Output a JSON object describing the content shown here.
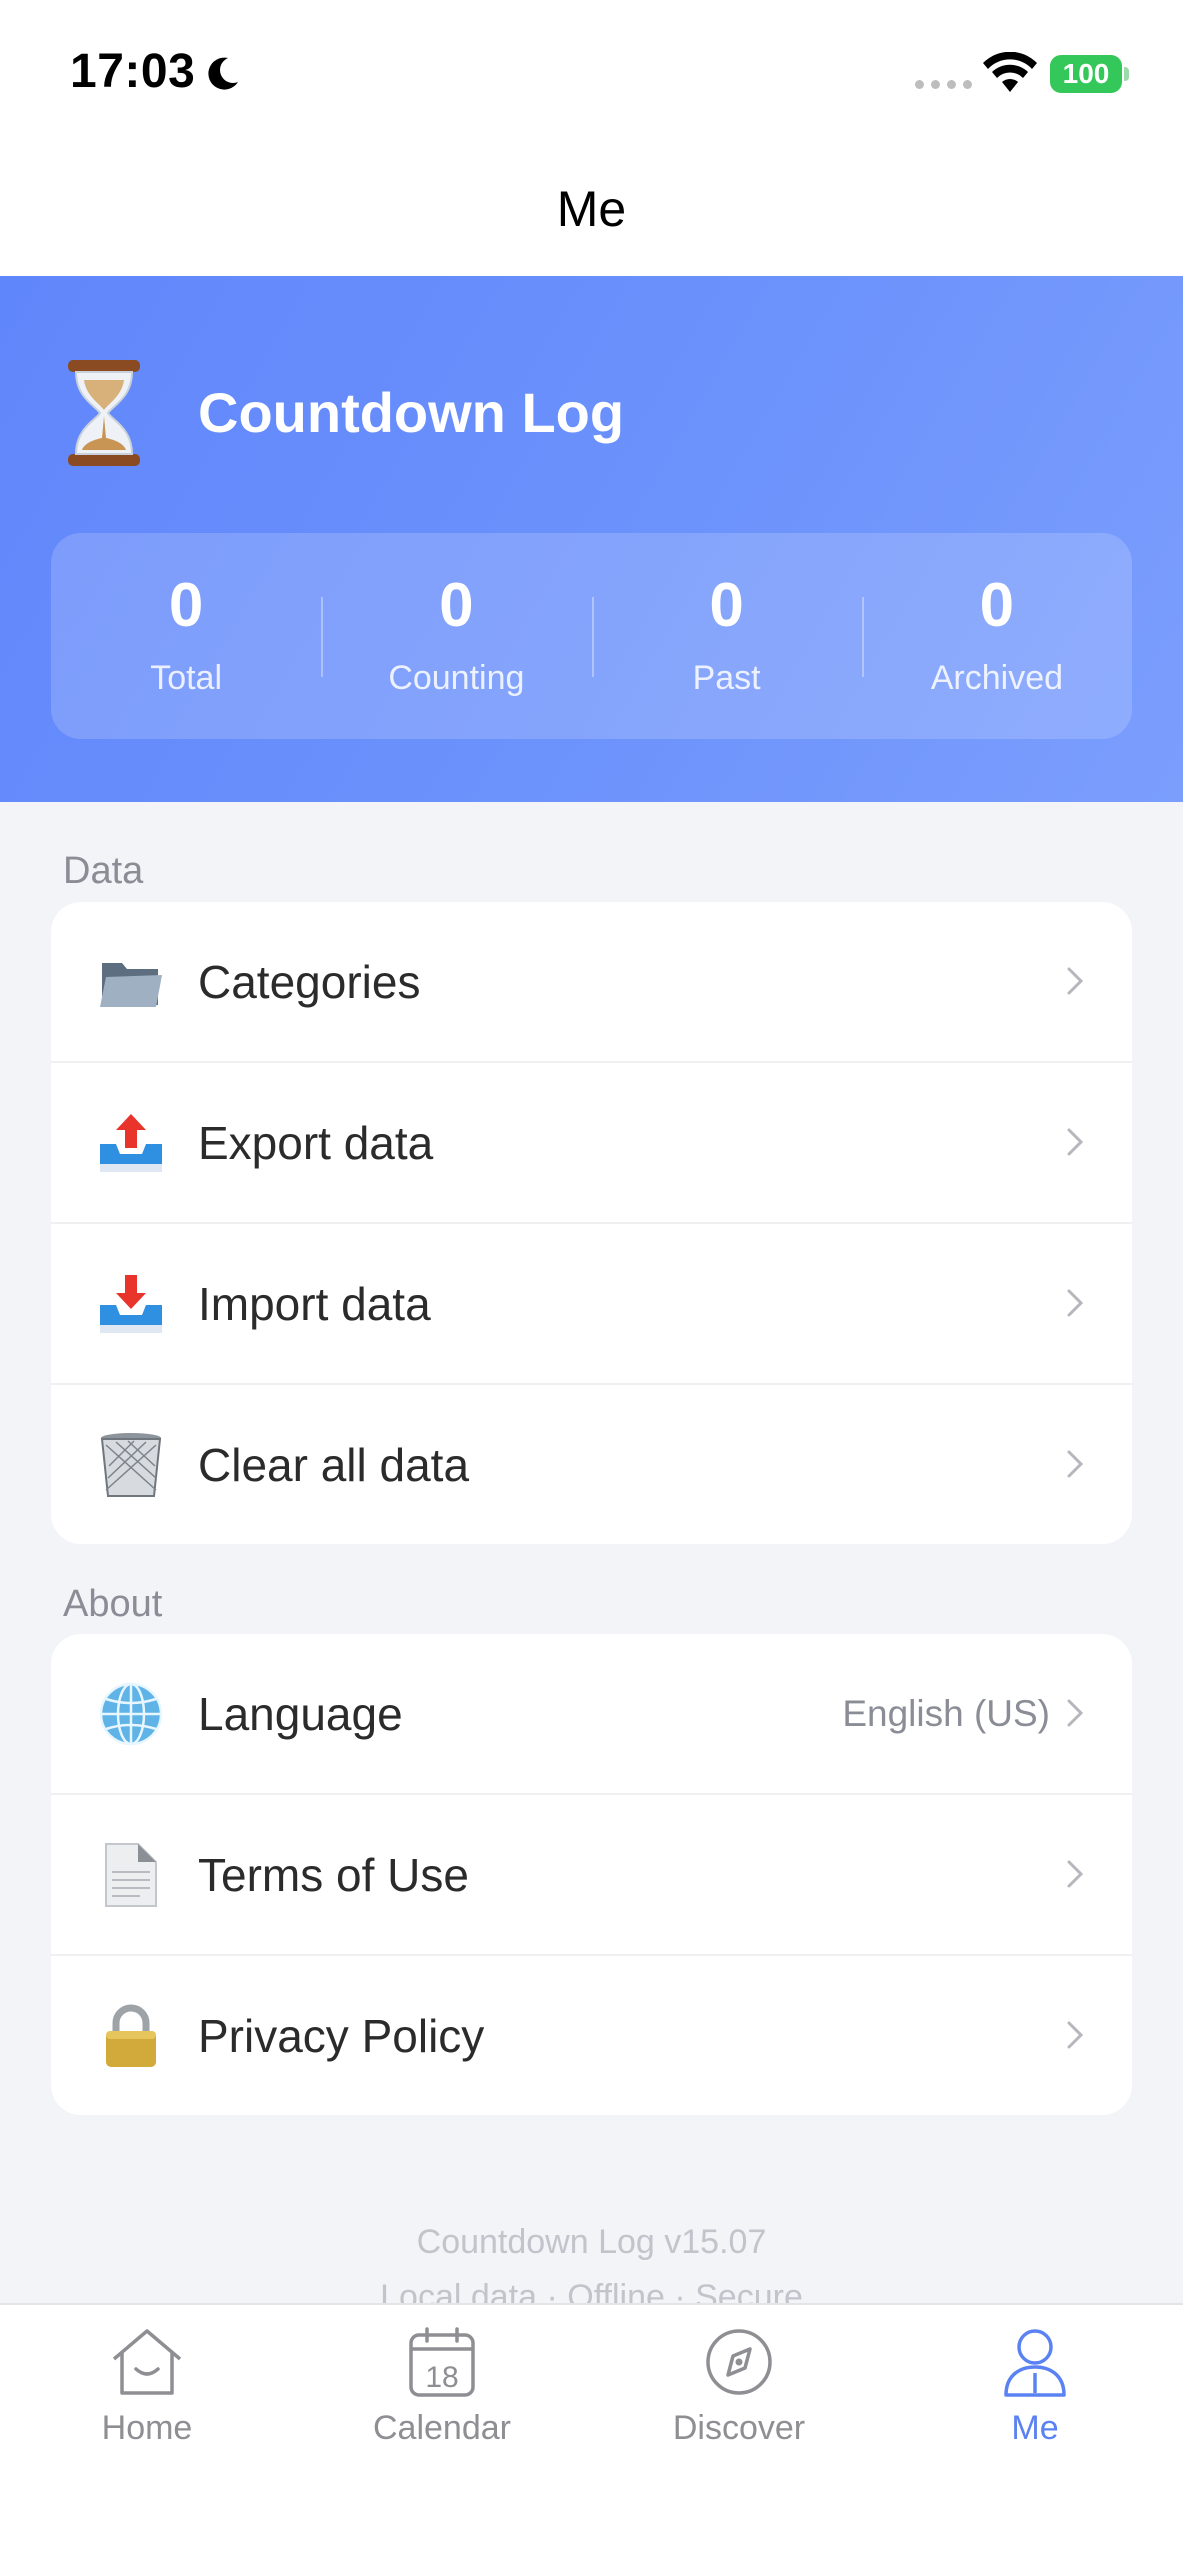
{
  "status_bar": {
    "time": "17:03",
    "battery": "100"
  },
  "nav": {
    "title": "Me"
  },
  "profile": {
    "app_name": "Countdown Log",
    "stats": [
      {
        "value": "0",
        "label": "Total"
      },
      {
        "value": "0",
        "label": "Counting"
      },
      {
        "value": "0",
        "label": "Past"
      },
      {
        "value": "0",
        "label": "Archived"
      }
    ]
  },
  "data_section": {
    "title": "Data",
    "items": [
      {
        "label": "Categories",
        "icon": "folder-icon"
      },
      {
        "label": "Export data",
        "icon": "outbox-icon"
      },
      {
        "label": "Import data",
        "icon": "inbox-icon"
      },
      {
        "label": "Clear all data",
        "icon": "trash-icon"
      }
    ]
  },
  "about_section": {
    "title": "About",
    "items": [
      {
        "label": "Language",
        "value": "English (US)",
        "icon": "globe-icon"
      },
      {
        "label": "Terms of Use",
        "icon": "document-icon"
      },
      {
        "label": "Privacy Policy",
        "icon": "lock-icon"
      }
    ]
  },
  "footer": {
    "version": "Countdown Log v15.07",
    "tagline": "Local data · Offline · Secure"
  },
  "tabbar": {
    "items": [
      {
        "label": "Home",
        "icon": "home-icon"
      },
      {
        "label": "Calendar",
        "icon": "calendar-icon",
        "day": "18"
      },
      {
        "label": "Discover",
        "icon": "compass-icon"
      },
      {
        "label": "Me",
        "icon": "person-icon"
      }
    ],
    "active": "Me",
    "active_color": "#5b82f3"
  },
  "colors": {
    "hero_start": "#6086fb",
    "hero_end": "#7b9efd",
    "battery": "#34c759"
  }
}
